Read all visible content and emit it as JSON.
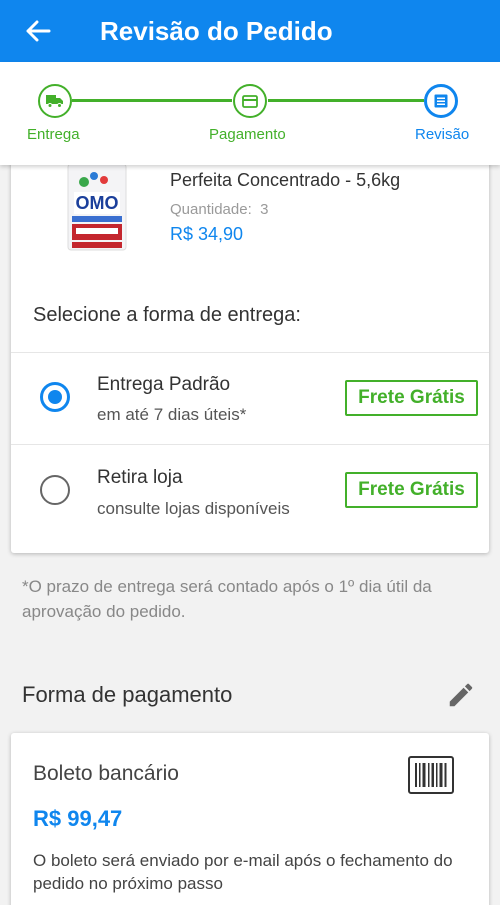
{
  "header": {
    "title": "Revisão do Pedido",
    "back_icon": "arrow-left-icon"
  },
  "stepper": {
    "steps": [
      {
        "label": "Entrega",
        "icon": "truck-icon",
        "state": "done"
      },
      {
        "label": "Pagamento",
        "icon": "card-icon",
        "state": "done"
      },
      {
        "label": "Revisão",
        "icon": "list-icon",
        "state": "current"
      }
    ]
  },
  "product": {
    "name_line": "Perfeita Concentrado - 5,6kg",
    "quantity_label": "Quantidade:",
    "quantity_value": "3",
    "price": "R$ 34,90",
    "brand": "OMO"
  },
  "delivery": {
    "title": "Selecione a forma de entrega:",
    "options": [
      {
        "title": "Entrega Padrão",
        "subtitle": "em até 7 dias úteis*",
        "badge": "Frete Grátis",
        "selected": true
      },
      {
        "title": "Retira loja",
        "subtitle": "consulte lojas disponíveis",
        "badge": "Frete Grátis",
        "selected": false
      }
    ],
    "note": "*O prazo de entrega será contado após o 1º dia útil da aprovação do pedido."
  },
  "payment": {
    "title": "Forma de pagamento",
    "method": "Boleto bancário",
    "total": "R$ 99,47",
    "description": "O boleto será enviado por e-mail após o fechamento do pedido no próximo passo"
  },
  "colors": {
    "primary": "#0f86ee",
    "success": "#43b02a"
  }
}
